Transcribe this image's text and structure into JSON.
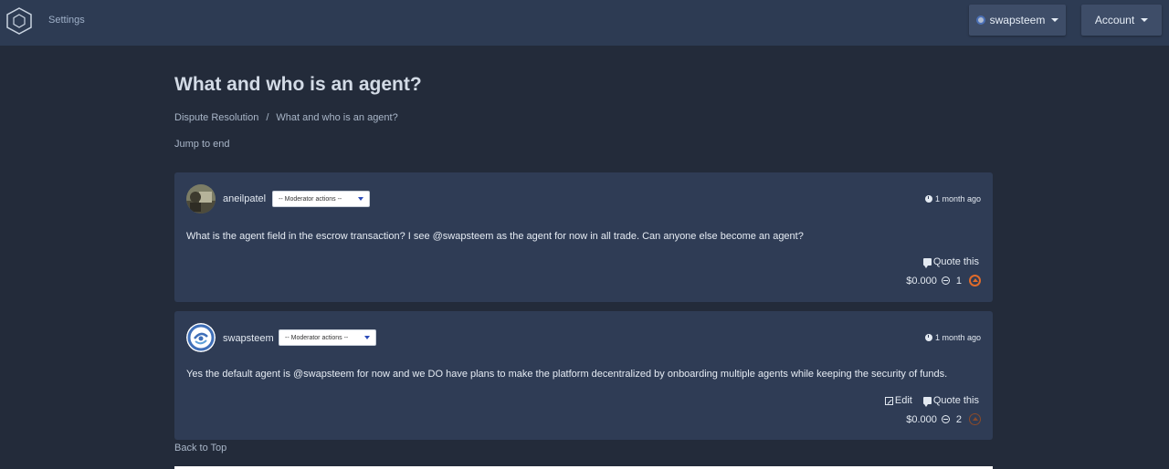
{
  "header": {
    "settings_label": "Settings",
    "wallet_label": "swapsteem",
    "account_label": "Account"
  },
  "page": {
    "title": "What and who is an agent?",
    "breadcrumb": [
      "Dispute Resolution",
      "/",
      "What and who is an agent?"
    ],
    "jump_label": "Jump to end",
    "back_to_top_label": "Back to Top"
  },
  "posts": [
    {
      "author": "aneilpatel",
      "moderator_select": "-- Moderator actions --",
      "time": "1 month ago",
      "body": "What is the agent field in the escrow transaction? I see @swapsteem as the agent for now in all trade. Can anyone else become an agent?",
      "quote_label": "Quote this",
      "payout": "$0.000",
      "votes": "1"
    },
    {
      "author": "swapsteem",
      "moderator_select": "-- Moderator actions --",
      "time": "1 month ago",
      "body": "Yes the default agent is @swapsteem for now and we DO have plans to make the platform decentralized by onboarding multiple agents while keeping the security of funds.",
      "edit_label": "Edit",
      "quote_label": "Quote this",
      "payout": "$0.000",
      "votes": "2"
    }
  ],
  "colors": {
    "background": "#232b3a",
    "topbar": "#2d3b53",
    "card": "#2f3c55",
    "upvote_accent": "#e06b2a"
  },
  "icons": [
    "logo-hexagon-icon",
    "wallet-icon",
    "caret-down-icon",
    "clock-icon",
    "quote-icon",
    "edit-icon",
    "vote-count-icon",
    "upvote-icon"
  ]
}
